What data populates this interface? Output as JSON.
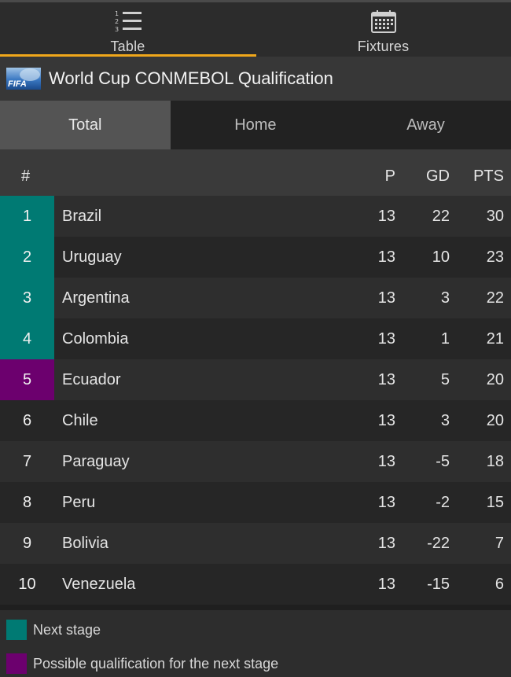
{
  "tabs": [
    {
      "label": "Table",
      "icon": "ranked-list-icon",
      "active": true
    },
    {
      "label": "Fixtures",
      "icon": "calendar-icon",
      "active": false
    }
  ],
  "header": {
    "title": "World Cup CONMEBOL Qualification",
    "logo": "FIFA"
  },
  "segments": [
    {
      "label": "Total",
      "active": true
    },
    {
      "label": "Home",
      "active": false
    },
    {
      "label": "Away",
      "active": false
    }
  ],
  "columns": {
    "pos": "#",
    "played": "P",
    "gd": "GD",
    "pts": "PTS"
  },
  "colors": {
    "accent": "#f0a71b",
    "next_stage": "#007a73",
    "possible": "#6c006e"
  },
  "rows": [
    {
      "pos": "1",
      "team": "Brazil",
      "p": "13",
      "gd": "22",
      "pts": "30",
      "status": "next"
    },
    {
      "pos": "2",
      "team": "Uruguay",
      "p": "13",
      "gd": "10",
      "pts": "23",
      "status": "next"
    },
    {
      "pos": "3",
      "team": "Argentina",
      "p": "13",
      "gd": "3",
      "pts": "22",
      "status": "next"
    },
    {
      "pos": "4",
      "team": "Colombia",
      "p": "13",
      "gd": "1",
      "pts": "21",
      "status": "next"
    },
    {
      "pos": "5",
      "team": "Ecuador",
      "p": "13",
      "gd": "5",
      "pts": "20",
      "status": "possible"
    },
    {
      "pos": "6",
      "team": "Chile",
      "p": "13",
      "gd": "3",
      "pts": "20",
      "status": ""
    },
    {
      "pos": "7",
      "team": "Paraguay",
      "p": "13",
      "gd": "-5",
      "pts": "18",
      "status": ""
    },
    {
      "pos": "8",
      "team": "Peru",
      "p": "13",
      "gd": "-2",
      "pts": "15",
      "status": ""
    },
    {
      "pos": "9",
      "team": "Bolivia",
      "p": "13",
      "gd": "-22",
      "pts": "7",
      "status": ""
    },
    {
      "pos": "10",
      "team": "Venezuela",
      "p": "13",
      "gd": "-15",
      "pts": "6",
      "status": ""
    }
  ],
  "legend": [
    {
      "label": "Next stage",
      "status": "next"
    },
    {
      "label": "Possible qualification for the next stage",
      "status": "possible"
    }
  ]
}
